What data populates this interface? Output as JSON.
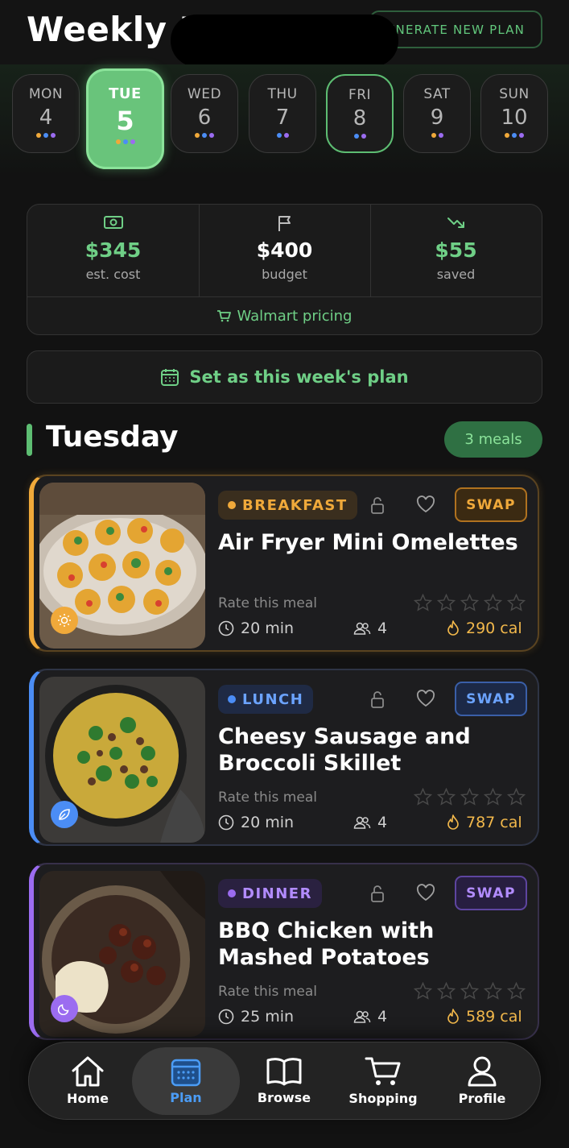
{
  "header": {
    "title": "Weekly Pl",
    "generate_label": "ENERATE NEW PLAN"
  },
  "days": [
    {
      "name": "MON",
      "num": "4"
    },
    {
      "name": "TUE",
      "num": "5"
    },
    {
      "name": "WED",
      "num": "6"
    },
    {
      "name": "THU",
      "num": "7"
    },
    {
      "name": "FRI",
      "num": "8"
    },
    {
      "name": "SAT",
      "num": "9"
    },
    {
      "name": "SUN",
      "num": "10"
    }
  ],
  "budget": {
    "est_cost": {
      "value": "$345",
      "label": "est. cost",
      "icon": "money-icon"
    },
    "budget": {
      "value": "$400",
      "label": "budget",
      "icon": "flag-icon"
    },
    "saved": {
      "value": "$55",
      "label": "saved",
      "icon": "trend-down-icon"
    },
    "pricing_label": "Walmart pricing"
  },
  "set_plan_label": "Set as this week's plan",
  "section": {
    "title": "Tuesday",
    "count_label": "3 meals"
  },
  "colors": {
    "accent_green": "#6fcf86",
    "breakfast": "#f0a93a",
    "lunch": "#4b8df5",
    "dinner": "#9b6cf0",
    "calories": "#f2b84b"
  },
  "meals": [
    {
      "type": "BREAKFAST",
      "name": "Air Fryer Mini Omelettes",
      "rate_label": "Rate this meal",
      "time": "20 min",
      "servings": "4",
      "calories": "290 cal",
      "swap_label": "SWAP",
      "badge_icon": "sun-icon"
    },
    {
      "type": "LUNCH",
      "name": "Cheesy Sausage and Broccoli Skillet",
      "rate_label": "Rate this meal",
      "time": "20 min",
      "servings": "4",
      "calories": "787 cal",
      "swap_label": "SWAP",
      "badge_icon": "leaf-icon"
    },
    {
      "type": "DINNER",
      "name": "BBQ Chicken with Mashed Potatoes",
      "rate_label": "Rate this meal",
      "time": "25 min",
      "servings": "4",
      "calories": "589 cal",
      "swap_label": "SWAP",
      "badge_icon": "moon-icon"
    }
  ],
  "nav": [
    {
      "label": "Home",
      "icon": "home-icon"
    },
    {
      "label": "Plan",
      "icon": "calendar-icon"
    },
    {
      "label": "Browse",
      "icon": "book-icon"
    },
    {
      "label": "Shopping",
      "icon": "cart-icon"
    },
    {
      "label": "Profile",
      "icon": "user-icon"
    }
  ]
}
